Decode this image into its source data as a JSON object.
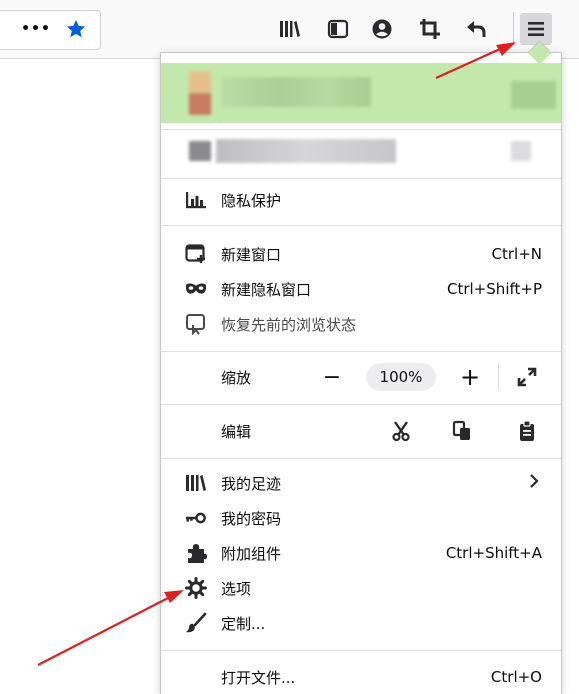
{
  "toolbar": {
    "buttons": [
      {
        "name": "page-actions-button",
        "icon": "ellipsis-icon",
        "glyph": "•••"
      },
      {
        "name": "bookmark-star-button",
        "icon": "star-icon",
        "color": "#0060df"
      },
      {
        "name": "library-button",
        "icon": "library-icon"
      },
      {
        "name": "sidebar-button",
        "icon": "sidebar-icon"
      },
      {
        "name": "account-button",
        "icon": "account-icon"
      },
      {
        "name": "screenshot-button",
        "icon": "crop-icon"
      },
      {
        "name": "back-button",
        "icon": "undo-icon"
      },
      {
        "name": "open-menu-button",
        "icon": "hamburger-icon"
      }
    ]
  },
  "menu": {
    "account_highlight_color": "#c3e8ab",
    "privacy": {
      "label": "隐私保护",
      "icon": "chart-icon"
    },
    "new_window": {
      "label": "新建窗口",
      "shortcut": "Ctrl+N",
      "icon": "new-window-icon"
    },
    "private_window": {
      "label": "新建隐私窗口",
      "shortcut": "Ctrl+Shift+P",
      "icon": "mask-icon"
    },
    "restore_session": {
      "label": "恢复先前的浏览状态",
      "icon": "restore-icon"
    },
    "zoom": {
      "label": "缩放",
      "minus": "−",
      "value": "100%",
      "plus": "+",
      "fullscreen_icon": "expand-icon"
    },
    "edit": {
      "label": "编辑",
      "cut_icon": "scissors-icon",
      "copy_icon": "copy-icon",
      "paste_icon": "clipboard-icon"
    },
    "library": {
      "label": "我的足迹",
      "icon": "library-icon",
      "chevron": "chevron-right-icon"
    },
    "passwords": {
      "label": "我的密码",
      "icon": "key-icon"
    },
    "addons": {
      "label": "附加组件",
      "shortcut": "Ctrl+Shift+A",
      "icon": "puzzle-icon"
    },
    "options": {
      "label": "选项",
      "icon": "gear-icon"
    },
    "customize": {
      "label": "定制...",
      "icon": "brush-icon"
    },
    "open_file": {
      "label": "打开文件...",
      "shortcut": "Ctrl+O"
    }
  },
  "annotations": {
    "arrow_color": "#e02020"
  }
}
